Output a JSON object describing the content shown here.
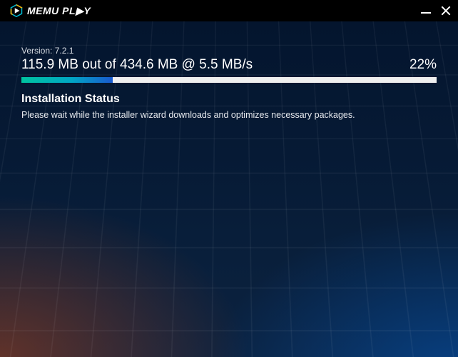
{
  "brand": {
    "name": "MEMU PLAY"
  },
  "window_controls": {
    "minimize": "minimize",
    "close": "close"
  },
  "installer": {
    "version_label": "Version: 7.2.1",
    "progress_text": "115.9 MB out of 434.6 MB @ 5.5 MB/s",
    "percent_label": "22%",
    "percent_value": 22,
    "status_heading": "Installation Status",
    "status_message": "Please wait while the installer wizard downloads and optimizes necessary packages."
  }
}
